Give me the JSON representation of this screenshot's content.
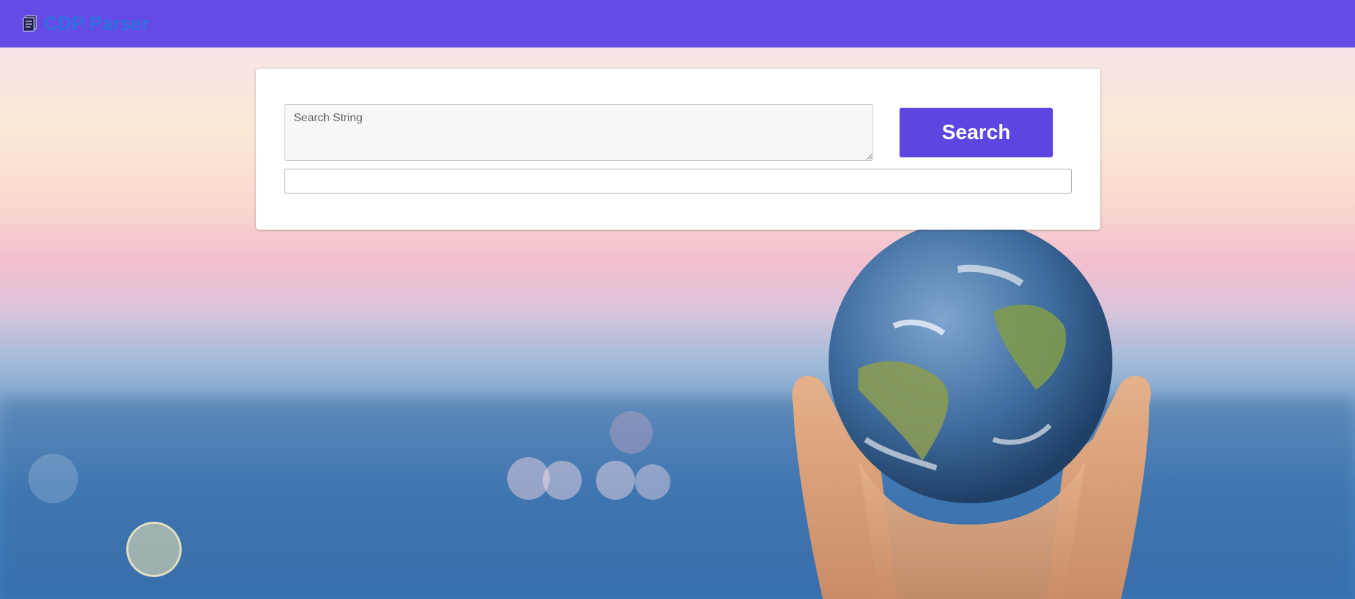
{
  "navbar": {
    "brand_icon": "document-icon",
    "brand_text": "CDP Parser",
    "background_color": "#654be6",
    "brand_color": "#2f6fdf"
  },
  "search": {
    "placeholder": "Search String",
    "value": "",
    "button_label": "Search",
    "button_color": "#5c46e2",
    "result_value": ""
  },
  "background": {
    "description_icon": "globe-in-hands-image"
  }
}
